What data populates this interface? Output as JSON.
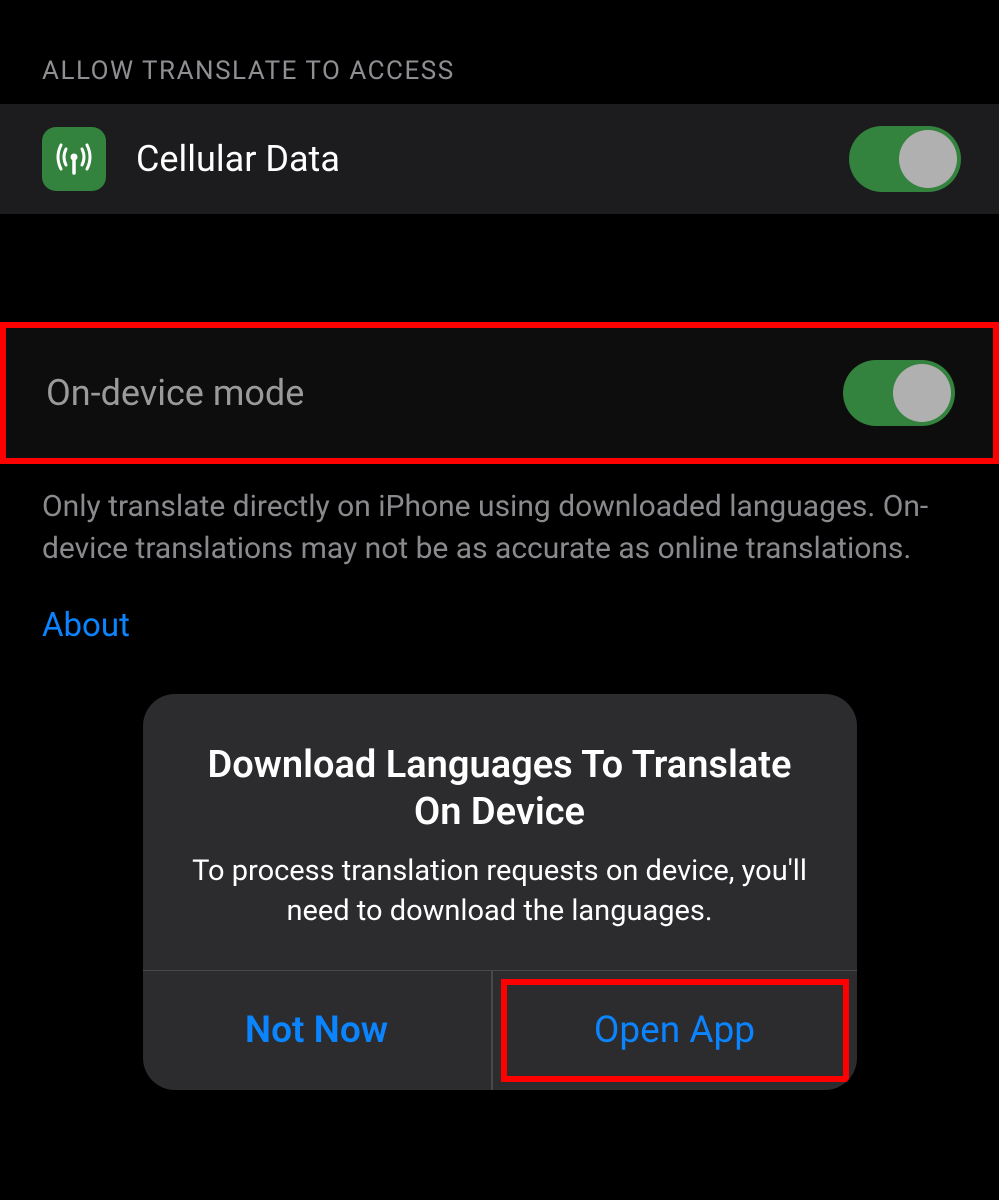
{
  "sections": {
    "access": {
      "header": "ALLOW TRANSLATE TO ACCESS",
      "cellular_data": {
        "label": "Cellular Data",
        "enabled": true
      }
    },
    "on_device": {
      "label": "On-device mode",
      "enabled": true,
      "description": "Only translate directly on iPhone using downloaded languages. On-device translations may not be as accurate as online translations.",
      "link_label": "About"
    }
  },
  "dialog": {
    "title": "Download Languages To Translate On Device",
    "message": "To process translation requests on device, you'll need to download the languages.",
    "buttons": {
      "cancel": "Not Now",
      "confirm": "Open App"
    }
  },
  "colors": {
    "toggle_on": "#33823d",
    "link": "#0a84ff",
    "highlight": "#ff0000"
  }
}
